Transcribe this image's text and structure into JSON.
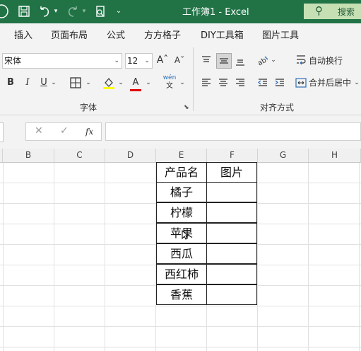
{
  "title_bar": {
    "document_title": "工作簿1  -  Excel",
    "search_label": "搜索",
    "quick_access": [
      "app-icon",
      "save-icon",
      "undo-icon",
      "redo-icon",
      "print-preview-icon",
      "customize-icon"
    ]
  },
  "ribbon": {
    "tabs": [
      "插入",
      "页面布局",
      "公式",
      "方方格子",
      "DIY工具箱",
      "图片工具"
    ],
    "font": {
      "name": "宋体",
      "size": "12",
      "increase_label": "Aˆ",
      "decrease_label": "Aˇ",
      "bold": "B",
      "italic": "I",
      "underline": "U",
      "font_color_label": "A",
      "phonetic_label": "wén",
      "group_label": "字体"
    },
    "alignment": {
      "wrap_text": "自动换行",
      "merge_center": "合并后居中",
      "group_label": "对齐方式"
    }
  },
  "formula_bar": {
    "cancel": "✕",
    "enter": "✓",
    "function": "fx"
  },
  "columns": [
    "B",
    "C",
    "D",
    "E",
    "F",
    "G",
    "H"
  ],
  "table": {
    "headers": [
      "产品名",
      "图片"
    ],
    "rows": [
      "橘子",
      "柠檬",
      "苹果",
      "西瓜",
      "西红柿",
      "香蕉"
    ]
  },
  "colors": {
    "title_bar": "#217346",
    "search_box": "#c6e0b4",
    "ribbon": "#f3f3f3",
    "highlight": "#ffff00",
    "font_color": "#e00000"
  }
}
